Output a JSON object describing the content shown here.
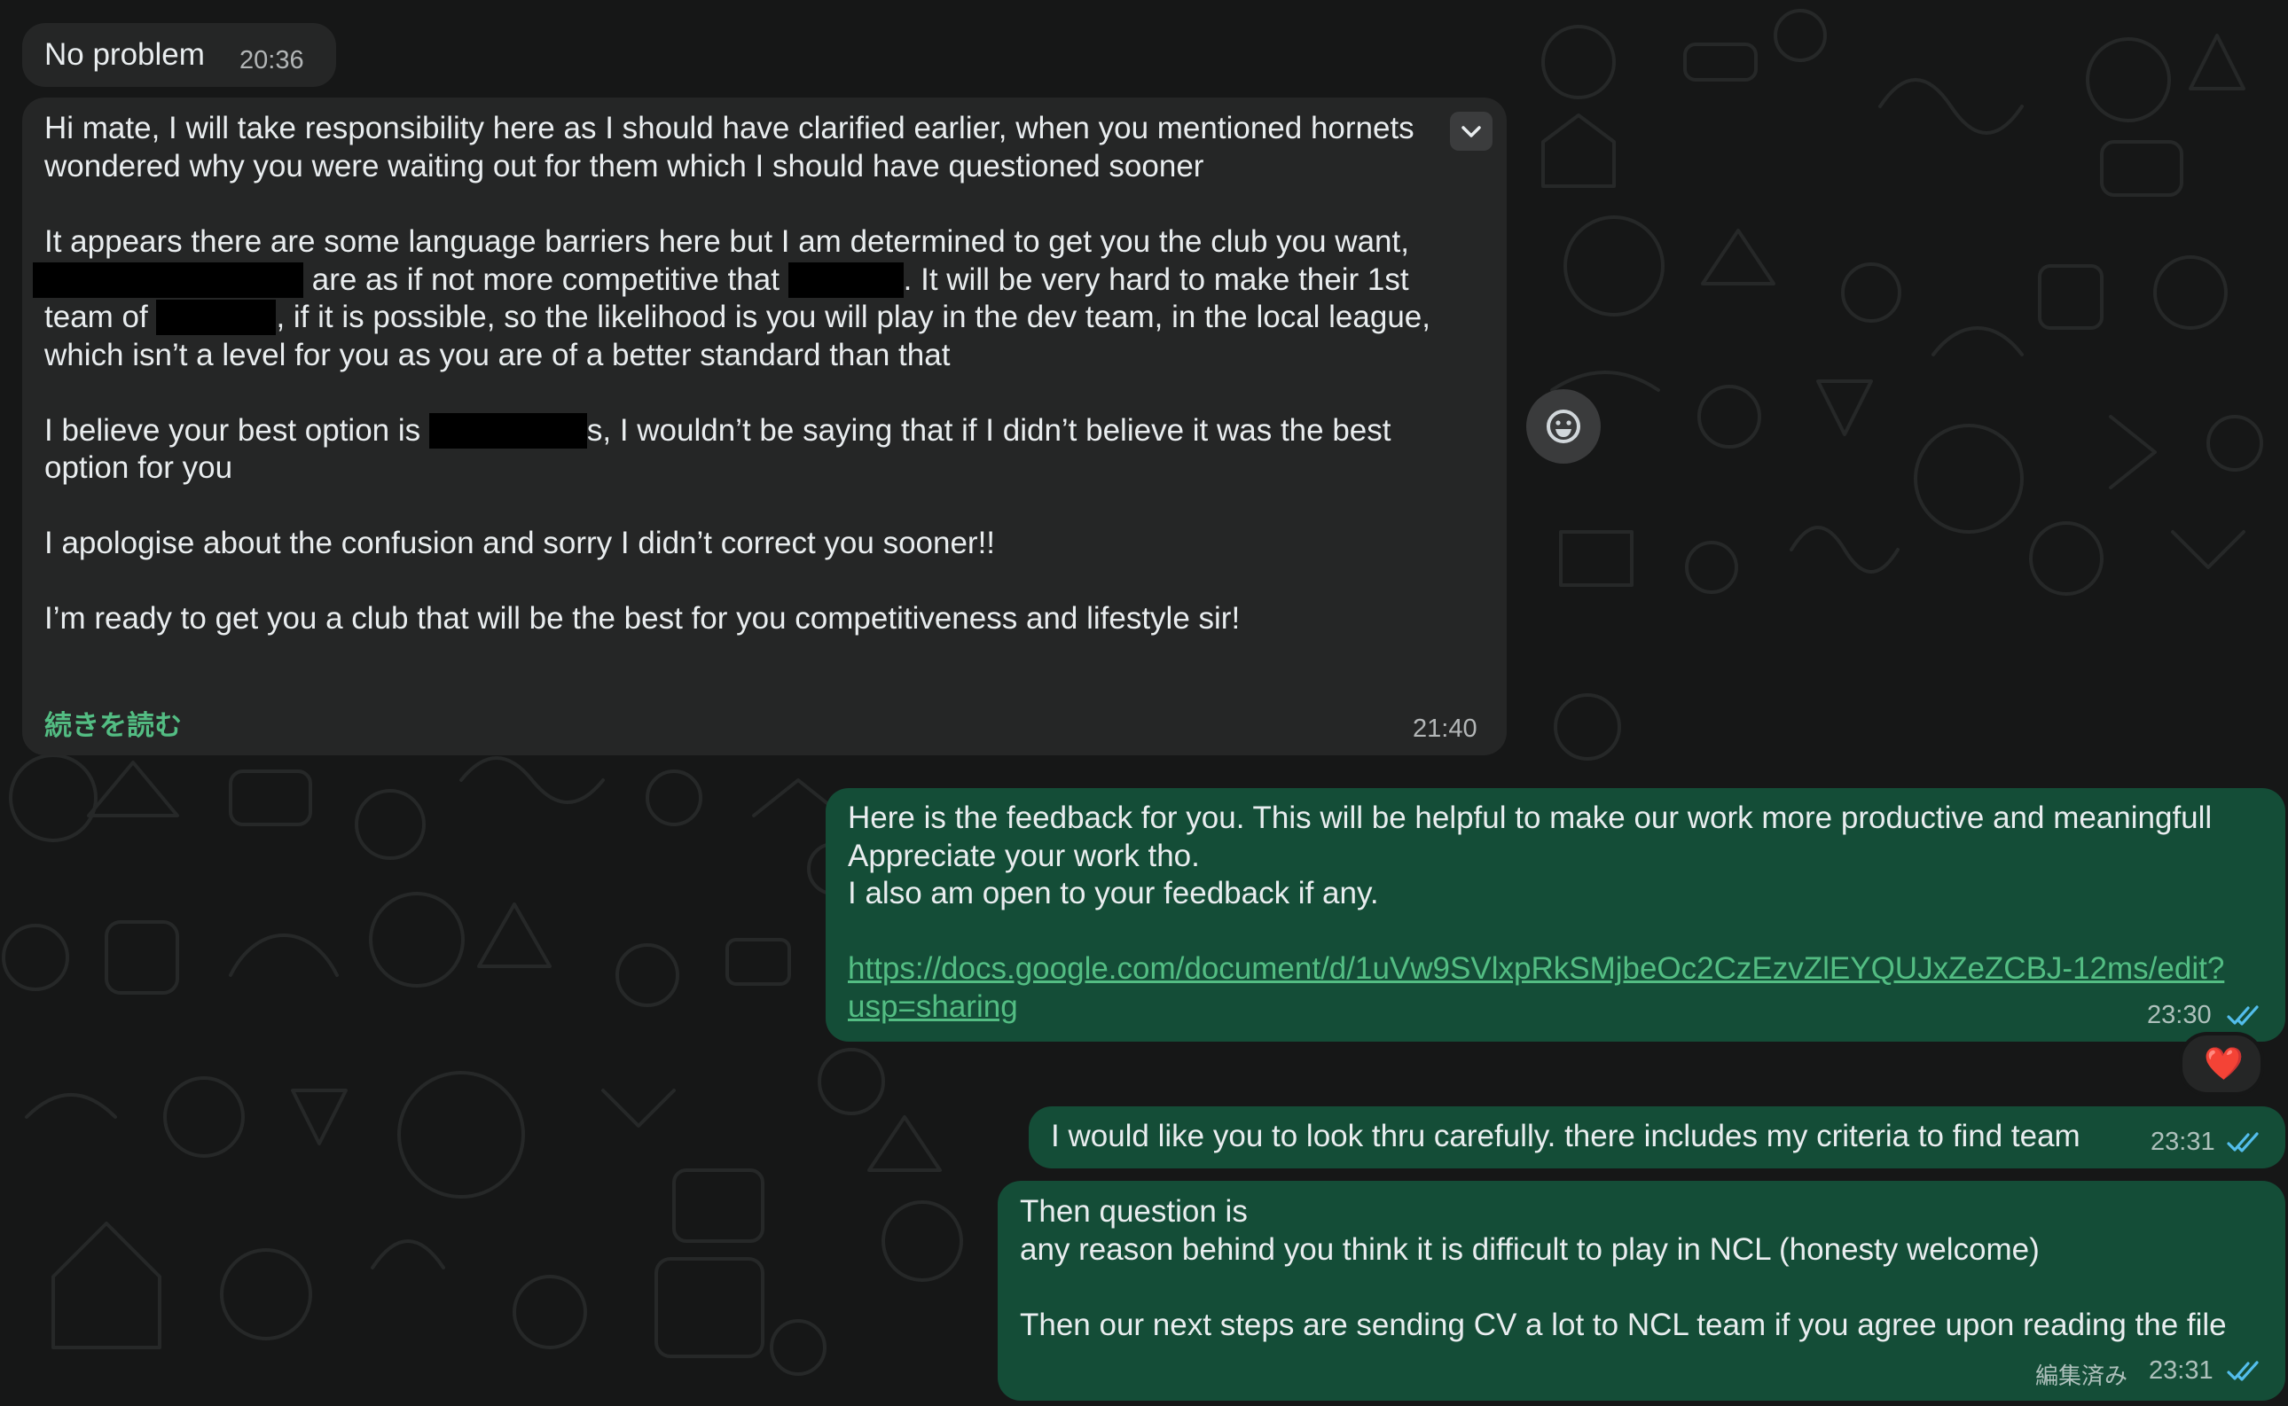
{
  "messages": {
    "m1": {
      "text": "No problem",
      "time": "20:36"
    },
    "m2": {
      "line1": "Hi mate, I will take responsibility here as I should have clarified earlier, when you mentioned hornets",
      "line2": "wondered why you were waiting out for them which I should have questioned sooner",
      "line3": "It appears there are some language barriers here but I am determined to get you the club you want,",
      "line4a": " are as if not more competitive that ",
      "line4b": ". It will be very hard to make their 1st",
      "line5a": "team of ",
      "line5b": ", if it is possible, so the likelihood is you will play in the dev team, in the local league,",
      "line6": "which isn’t a level for you as you are of a better standard than that",
      "line7a": "I believe your best option is ",
      "line7b": "s, I wouldn’t be saying that if I didn’t believe it was the best",
      "line8": "option for you",
      "line9": "I apologise about the confusion and sorry I didn’t correct you sooner!!",
      "line10": "I’m ready to get you a club that will be the best for you competitiveness and lifestyle sir!",
      "read_more": "続きを読む",
      "time": "21:40"
    },
    "m3": {
      "line1": "Here is the feedback for you. This will be helpful to make our work more productive and meaningfull",
      "line2": "Appreciate your work tho.",
      "line3": "I also am open to your feedback if any.",
      "link1": "https://docs.google.com/document/d/1uVw9SVlxpRkSMjbeOc2CzEzvZlEYQUJxZeZCBJ-12ms/edit?",
      "link2": "usp=sharing",
      "time": "23:30",
      "reaction": "❤️"
    },
    "m4": {
      "text": "I would like you to look thru carefully. there includes my criteria to find team",
      "time": "23:31"
    },
    "m5": {
      "line1": "Then question is",
      "line2": "any reason behind you think it is difficult to play in NCL (honesty welcome)",
      "line3": "Then our next steps are sending CV a lot to NCL team if you agree upon reading the file",
      "edited": "編集済み",
      "time": "23:31"
    }
  },
  "icons": {
    "chevron": "chevron-down-icon",
    "emoji": "emoji-reaction-icon",
    "read": "double-check-icon"
  },
  "colors": {
    "background": "#161717",
    "incoming_bubble": "#252626",
    "outgoing_bubble": "#144d37",
    "link": "#53bd83",
    "read_tick": "#53bdeb"
  }
}
